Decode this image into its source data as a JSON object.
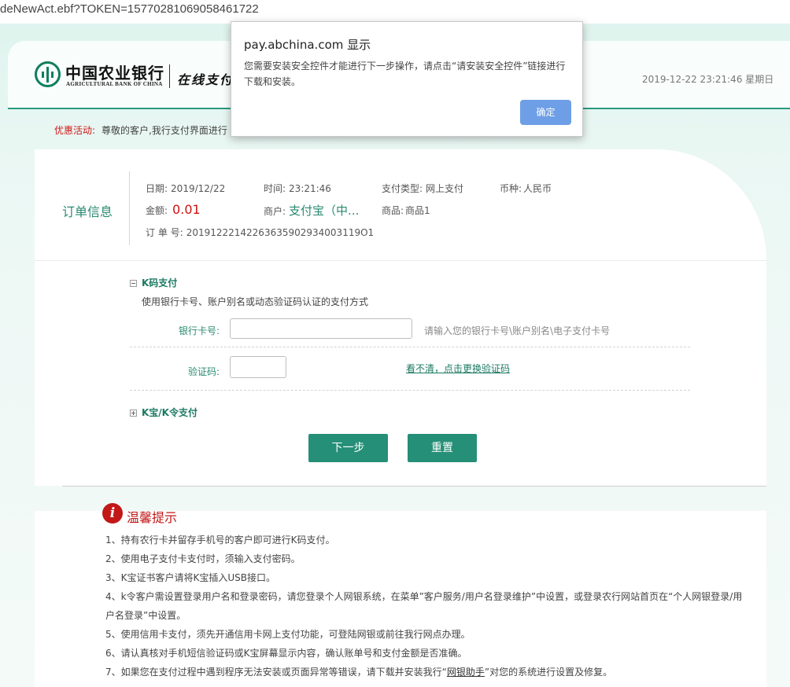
{
  "browser": {
    "url": "deNewAct.ebf?TOKEN=15770281069058461722"
  },
  "header": {
    "bank_name_cn": "中国农业银行",
    "bank_name_en": "AGRICULTURAL BANK OF CHINA",
    "service_name": "在线支付",
    "datetime": "2019-12-22 23:21:46 星期日",
    "brand_color": "#0e7f5c"
  },
  "promo": {
    "label": "优惠活动:",
    "text": "尊敬的客户,我行支付界面进行"
  },
  "order": {
    "title": "订单信息",
    "date_label": "日期:",
    "date": "2019/12/22",
    "time_label": "时间:",
    "time": "23:21:46",
    "pay_type_label": "支付类型:",
    "pay_type": "网上支付",
    "currency_label": "币种:",
    "currency": "人民币",
    "amount_label": "金额:",
    "amount": "0.01",
    "merchant_label": "商户:",
    "merchant": "支付宝（中...",
    "product_label": "商品:",
    "product": "商品1",
    "order_no_label": "订 单 号:",
    "order_no": "20191222142263635902934003119O1"
  },
  "kpay": {
    "title": "K码支付",
    "description": "使用银行卡号、账户别名或动态验证码认证的支付方式",
    "card_label": "银行卡号:",
    "card_value": "",
    "card_hint": "请输入您的银行卡号\\账户别名\\电子支付卡号",
    "captcha_label": "验证码:",
    "captcha_value": "",
    "captcha_refresh": "看不清，点击更换验证码"
  },
  "kbao": {
    "title": "K宝/K令支付"
  },
  "buttons": {
    "next": "下一步",
    "reset": "重置"
  },
  "tips": {
    "title": "温馨提示",
    "items": [
      "1、持有农行卡并留存手机号的客户即可进行K码支付。",
      "2、使用电子支付卡支付时，须输入支付密码。",
      "3、K宝证书客户请将K宝插入USB接口。",
      "4、k令客户需设置登录用户名和登录密码，请您登录个人网银系统，在菜单”客户服务/用户名登录维护”中设置，或登录农行网站首页在“个人网银登录/用户名登录”中设置。",
      "5、使用信用卡支付，须先开通信用卡网上支付功能，可登陆网银或前往我行网点办理。",
      "6、请认真核对手机短信验证码或K宝屏幕显示内容，确认账单号和支付金额是否准确。"
    ],
    "item7_prefix": "7、如果您在支付过程中遇到程序无法安装或页面异常等错误，请下载并安装我行“",
    "item7_link": "网银助手",
    "item7_suffix": "”对您的系统进行设置及修复。"
  },
  "dialog": {
    "title": "pay.abchina.com 显示",
    "message": "您需要安装安全控件才能进行下一步操作，请点击“请安装安全控件”链接进行下载和安装。",
    "ok": "确定"
  }
}
